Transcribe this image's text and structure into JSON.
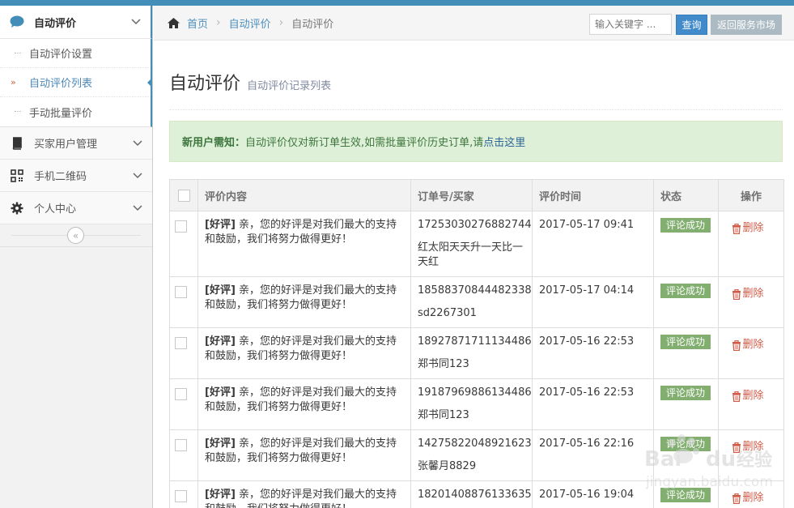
{
  "sidebar": {
    "section_title": "自动评价",
    "sub_items": [
      {
        "label": "自动评价设置",
        "active": false
      },
      {
        "label": "自动评价列表",
        "active": true
      },
      {
        "label": "手动批量评价",
        "active": false
      }
    ],
    "items": [
      {
        "label": "买家用户管理",
        "icon": "book-icon"
      },
      {
        "label": "手机二维码",
        "icon": "qrcode-icon"
      },
      {
        "label": "个人中心",
        "icon": "gear-icon"
      }
    ],
    "collapse_icon": "double-chevron-left-icon"
  },
  "breadcrumb": {
    "home": "首页",
    "level2": "自动评价",
    "current": "自动评价"
  },
  "search": {
    "placeholder": "输入关键字 ...",
    "query_label": "查询",
    "back_label": "返回服务市场"
  },
  "page": {
    "title": "自动评价",
    "subtitle": "自动评价记录列表"
  },
  "notice": {
    "prefix": "新用户需知：",
    "text": "自动评价仅对新订单生效,如需批量评价历史订单,请",
    "link": "点击这里"
  },
  "table": {
    "headers": [
      "评价内容",
      "订单号/买家",
      "评价时间",
      "状态",
      "操作"
    ],
    "rows": [
      {
        "kind": "[好评]",
        "content": " 亲，您的好评是对我们最大的支持和鼓励，我们将努力做得更好！",
        "order": "17253030276882744",
        "buyer": "红太阳天天升一天比一天红",
        "time": "2017-05-17 09:41",
        "status": "评论成功",
        "action": "删除"
      },
      {
        "kind": "[好评]",
        "content": " 亲，您的好评是对我们最大的支持和鼓励，我们将努力做得更好！",
        "order": "18588370844482338",
        "buyer": "sd2267301",
        "time": "2017-05-17 04:14",
        "status": "评论成功",
        "action": "删除"
      },
      {
        "kind": "[好评]",
        "content": " 亲，您的好评是对我们最大的支持和鼓励，我们将努力做得更好！",
        "order": "18927871711134486",
        "buyer": "郑书同123",
        "time": "2017-05-16 22:53",
        "status": "评论成功",
        "action": "删除"
      },
      {
        "kind": "[好评]",
        "content": " 亲，您的好评是对我们最大的支持和鼓励，我们将努力做得更好！",
        "order": "19187969886134486",
        "buyer": "郑书同123",
        "time": "2017-05-16 22:53",
        "status": "评论成功",
        "action": "删除"
      },
      {
        "kind": "[好评]",
        "content": " 亲，您的好评是对我们最大的支持和鼓励，我们将努力做得更好！",
        "order": "14275822048921623",
        "buyer": "张馨月8829",
        "time": "2017-05-16 22:16",
        "status": "评论成功",
        "action": "删除"
      },
      {
        "kind": "[好评]",
        "content": " 亲，您的好评是对我们最大的支持和鼓励，我们将努力做得更好！",
        "order": "18201408876133635",
        "buyer": "",
        "time": "2017-05-16 19:04",
        "status": "评论成功",
        "action": "删除"
      }
    ]
  },
  "watermark": {
    "text": "Baidu经验",
    "url_text": "jingyan.baidu.com"
  },
  "colors": {
    "accent": "#438eb9",
    "success": "#82af6f",
    "danger": "#d15b47",
    "alert_bg": "#dff0d8"
  }
}
